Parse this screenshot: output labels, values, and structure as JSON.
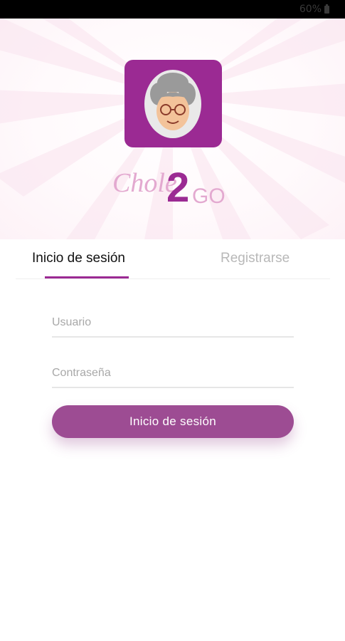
{
  "status_bar": {
    "battery_percent": "60%"
  },
  "brand": {
    "name_left": "Chole",
    "name_num": "2",
    "name_right": "GO",
    "purple": "#9b2a93",
    "pink": "#e3a9d0"
  },
  "tabs": [
    {
      "label": "Inicio de sesión",
      "active": true
    },
    {
      "label": "Registrarse",
      "active": false
    }
  ],
  "form": {
    "username_placeholder": "Usuario",
    "password_placeholder": "Contraseña",
    "submit_label": "Inicio de sesión"
  }
}
